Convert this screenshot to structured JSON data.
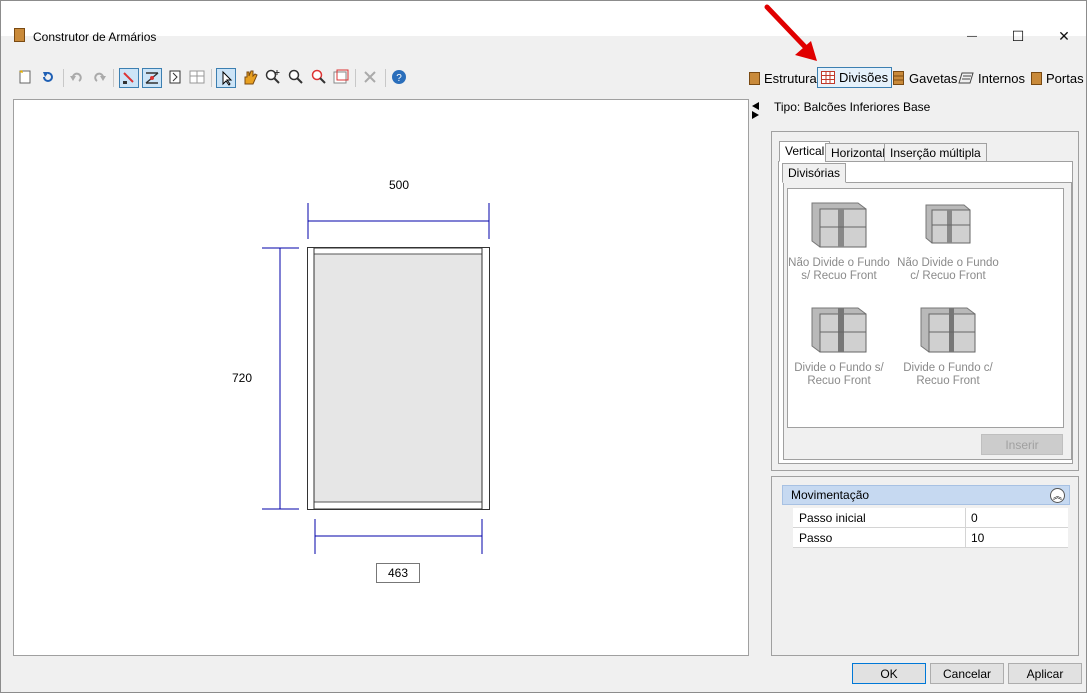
{
  "window": {
    "title": "Construtor de Armários",
    "minimize": "—",
    "maximize": "☐",
    "close": "✕"
  },
  "toolbar": {
    "tools": [
      "new-icon",
      "refresh-icon",
      "undo-icon",
      "redo-icon",
      "select-edit-icon",
      "measure-icon",
      "divider-tool-icon",
      "grid-icon",
      "pointer-icon",
      "pan-icon",
      "zoom-in-icon",
      "zoom-icon",
      "zoom-extents-icon",
      "window-icon",
      "delete-icon",
      "help-icon"
    ]
  },
  "nav_tabs": [
    {
      "label": "Estrutura",
      "icon": "cabinet-icon"
    },
    {
      "label": "Divisões",
      "icon": "grid-divisions-icon",
      "active": true
    },
    {
      "label": "Gavetas",
      "icon": "drawer-icon"
    },
    {
      "label": "Internos",
      "icon": "internals-icon"
    },
    {
      "label": "Portas",
      "icon": "door-icon"
    }
  ],
  "panel": {
    "type_label": "Tipo: Balcões Inferiores Base",
    "tabs": [
      "Vertical",
      "Horizontal",
      "Inserção múltipla"
    ],
    "subtab": "Divisórias",
    "items": [
      {
        "label": "Não Divide o Fundo s/ Recuo Front"
      },
      {
        "label": "Não Divide o Fundo c/ Recuo Front"
      },
      {
        "label": "Divide o Fundo s/ Recuo Front"
      },
      {
        "label": "Divide o Fundo c/ Recuo Front"
      }
    ],
    "insert_button": "Inserir"
  },
  "movimentacao": {
    "header": "Movimentação",
    "rows": [
      {
        "key": "Passo inicial",
        "value": "0"
      },
      {
        "key": "Passo",
        "value": "10"
      }
    ]
  },
  "drawing": {
    "width_dim": "500",
    "height_dim": "720",
    "inner_width_dim": "463"
  },
  "footer": {
    "ok": "OK",
    "cancel": "Cancelar",
    "apply": "Aplicar"
  },
  "colors": {
    "accent": "#0078d7",
    "dimension_line": "#0000aa",
    "annotation_arrow": "#e00000",
    "cabinet_fill": "#e6e6e6"
  }
}
